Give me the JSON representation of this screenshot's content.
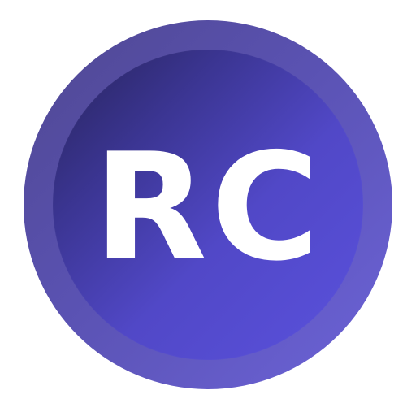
{
  "icon": {
    "monogram": "RC",
    "colors": {
      "outer_ring_start": "#4f4790",
      "outer_ring_end": "#6c63d9",
      "inner_disc_start": "#27235a",
      "inner_disc_end": "#5a51dd",
      "text": "#ffffff",
      "background": "#ffffff"
    }
  }
}
